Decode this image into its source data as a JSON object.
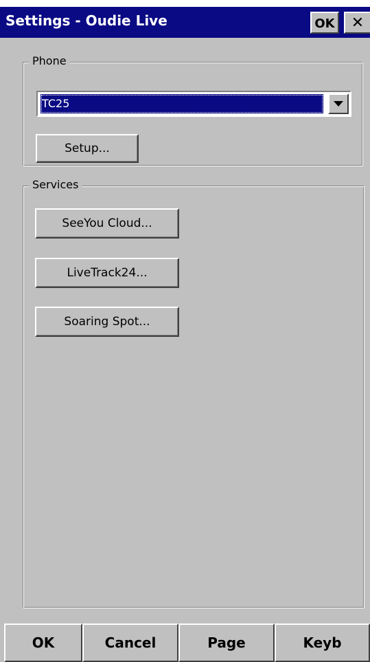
{
  "window": {
    "title": "Settings - Oudie Live",
    "ok_label": "OK",
    "close_glyph": "✕"
  },
  "phone": {
    "label": "Phone",
    "selected": "TC25",
    "setup_label": "Setup..."
  },
  "services": {
    "label": "Services",
    "buttons": [
      "SeeYou Cloud...",
      "LiveTrack24...",
      "Soaring Spot..."
    ]
  },
  "bottom_bar": {
    "buttons": [
      "OK",
      "Cancel",
      "Page",
      "Keyb"
    ]
  },
  "colors": {
    "titlebar": "#0a0a84",
    "face": "#c0c0c0",
    "selection": "#0a0a84"
  },
  "icons": {
    "combo_arrow": "chevron-down-icon",
    "close": "close-icon"
  }
}
